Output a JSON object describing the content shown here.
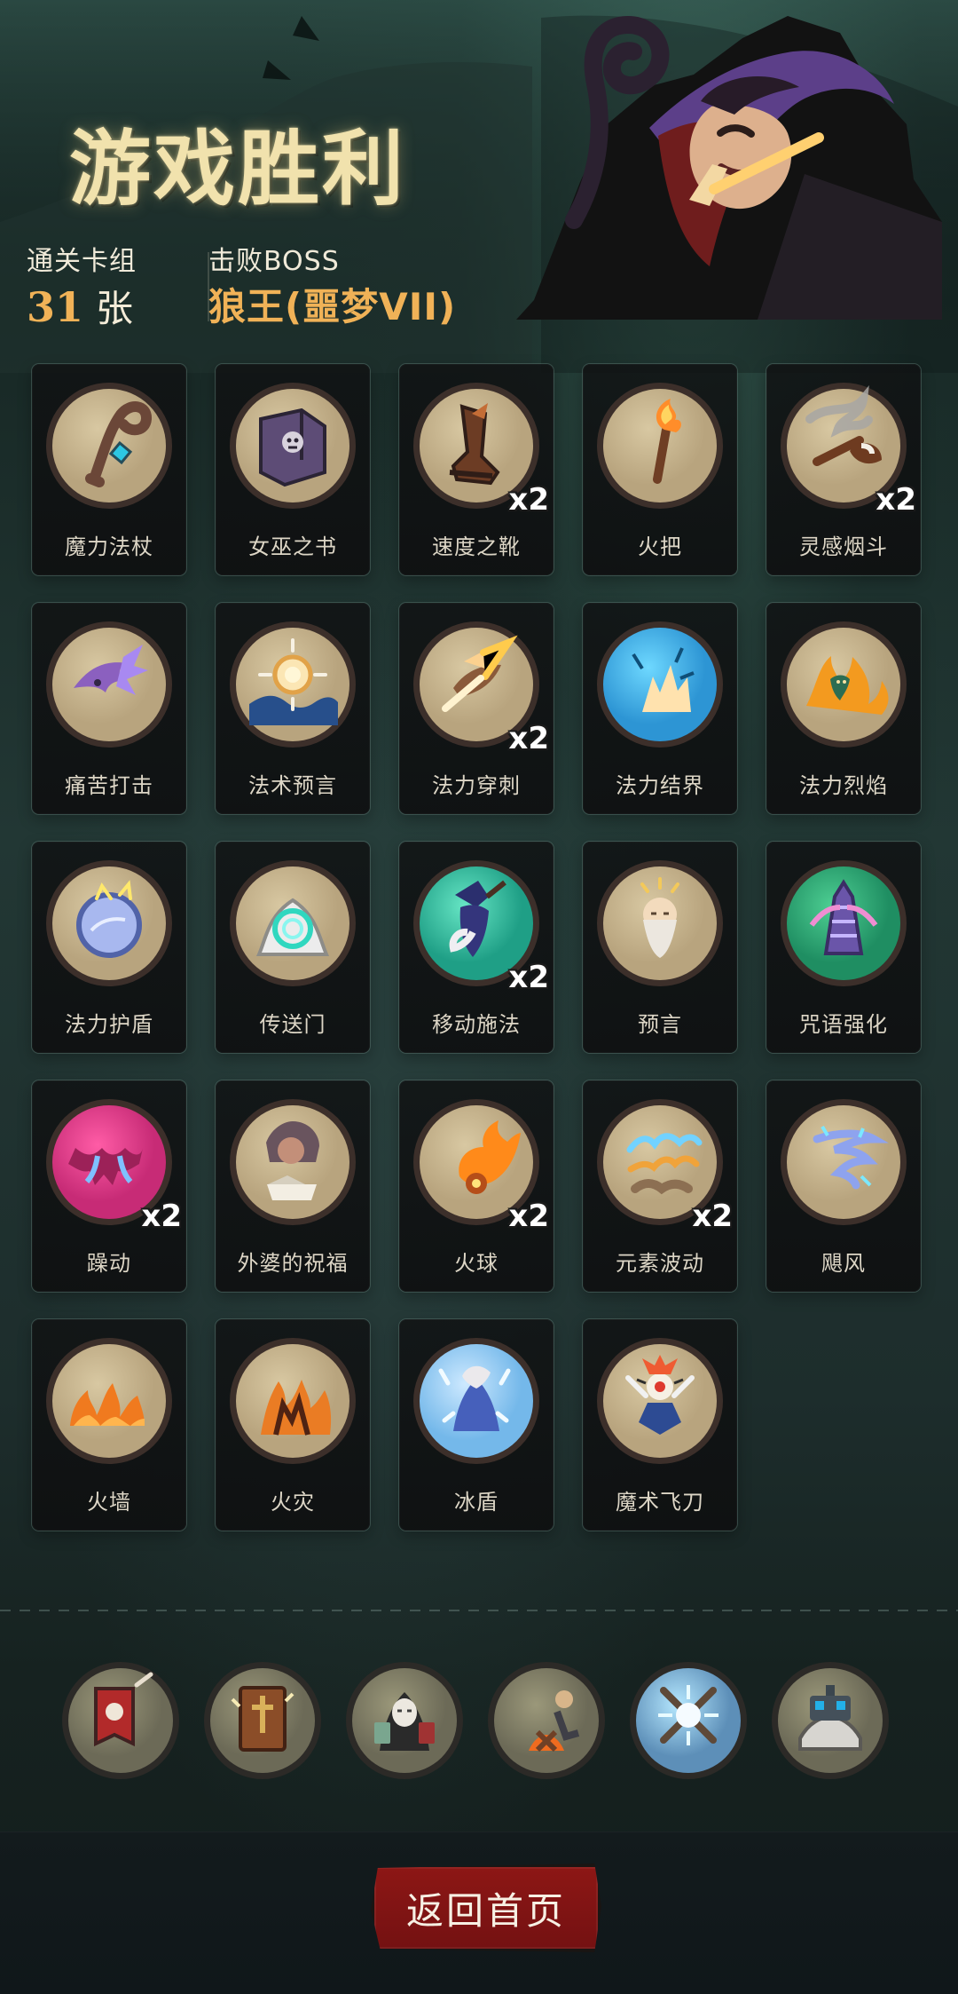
{
  "title": "游戏胜利",
  "stats": {
    "cards_label": "通关卡组",
    "cards_value": "31",
    "cards_unit": "张",
    "boss_label": "击败BOSS",
    "boss_name": "狼王(噩梦VII)"
  },
  "deck": [
    {
      "label": "魔力法杖",
      "icon": "magic-staff-icon"
    },
    {
      "label": "女巫之书",
      "icon": "witch-book-icon"
    },
    {
      "label": "速度之靴",
      "icon": "speed-boots-icon",
      "count": "x2"
    },
    {
      "label": "火把",
      "icon": "torch-icon"
    },
    {
      "label": "灵感烟斗",
      "icon": "inspiration-pipe-icon",
      "count": "x2"
    },
    {
      "label": "痛苦打击",
      "icon": "pain-strike-icon"
    },
    {
      "label": "法术预言",
      "icon": "spell-prophecy-icon"
    },
    {
      "label": "法力穿刺",
      "icon": "mana-pierce-icon",
      "count": "x2"
    },
    {
      "label": "法力结界",
      "icon": "mana-barrier-icon"
    },
    {
      "label": "法力烈焰",
      "icon": "mana-flame-icon"
    },
    {
      "label": "法力护盾",
      "icon": "mana-shield-icon"
    },
    {
      "label": "传送门",
      "icon": "portal-icon"
    },
    {
      "label": "移动施法",
      "icon": "moving-cast-icon",
      "count": "x2"
    },
    {
      "label": "预言",
      "icon": "prophecy-icon"
    },
    {
      "label": "咒语强化",
      "icon": "spell-boost-icon"
    },
    {
      "label": "躁动",
      "icon": "restless-icon",
      "count": "x2"
    },
    {
      "label": "外婆的祝福",
      "icon": "grandma-blessing-icon"
    },
    {
      "label": "火球",
      "icon": "fireball-icon",
      "count": "x2"
    },
    {
      "label": "元素波动",
      "icon": "elemental-wave-icon",
      "count": "x2"
    },
    {
      "label": "飓风",
      "icon": "hurricane-icon"
    },
    {
      "label": "火墙",
      "icon": "fire-wall-icon"
    },
    {
      "label": "火灾",
      "icon": "wildfire-icon"
    },
    {
      "label": "冰盾",
      "icon": "ice-shield-icon"
    },
    {
      "label": "魔术飞刀",
      "icon": "magic-knife-icon"
    }
  ],
  "unlocks": [
    {
      "icon": "banner-skull-icon"
    },
    {
      "icon": "holy-book-icon"
    },
    {
      "icon": "masked-rogue-icon"
    },
    {
      "icon": "campfire-warrior-icon"
    },
    {
      "icon": "crossed-staffs-icon"
    },
    {
      "icon": "robot-book-icon"
    }
  ],
  "footer": {
    "button_label": "返回首页"
  }
}
